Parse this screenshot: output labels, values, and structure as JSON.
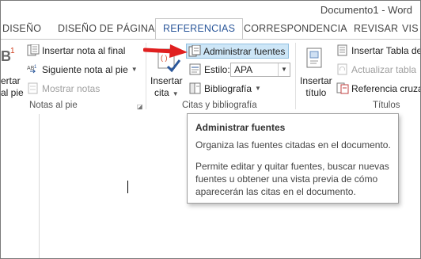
{
  "window": {
    "title": "Documento1 - Word"
  },
  "tabs": [
    {
      "label": "DISEÑO"
    },
    {
      "label": "DISEÑO DE PÁGINA"
    },
    {
      "label": "REFERENCIAS"
    },
    {
      "label": "CORRESPONDENCIA"
    },
    {
      "label": "REVISAR"
    },
    {
      "label": "VIS"
    }
  ],
  "ribbon": {
    "footnotes": {
      "big_button_line1": "ertar",
      "big_button_line2": "al pie",
      "insert_endnote": "Insertar nota al final",
      "next_footnote": "Siguiente nota al pie",
      "show_notes": "Mostrar notas",
      "group_label": "Notas al pie"
    },
    "citations": {
      "insert_citation_line1": "Insertar",
      "insert_citation_line2": "cita",
      "manage_sources": "Administrar fuentes",
      "style_label": "Estilo:",
      "style_value": "APA",
      "bibliography": "Bibliografía",
      "group_label": "Citas y bibliografía"
    },
    "captions": {
      "insert_caption_line1": "Insertar",
      "insert_caption_line2": "título",
      "insert_table_of_figures": "Insertar Tabla de",
      "update_table": "Actualizar tabla",
      "cross_reference": "Referencia cruzad",
      "group_label": "Títulos"
    }
  },
  "tooltip": {
    "title": "Administrar fuentes",
    "line1": "Organiza las fuentes citadas en el documento.",
    "line2": "Permite editar y quitar fuentes, buscar nuevas",
    "line3": "fuentes u obtener una vista previa de cómo",
    "line4": "aparecerán las citas en el documento."
  },
  "colors": {
    "accent": "#2b579a",
    "arrow": "#e02020",
    "highlight": "#cde6f7"
  }
}
